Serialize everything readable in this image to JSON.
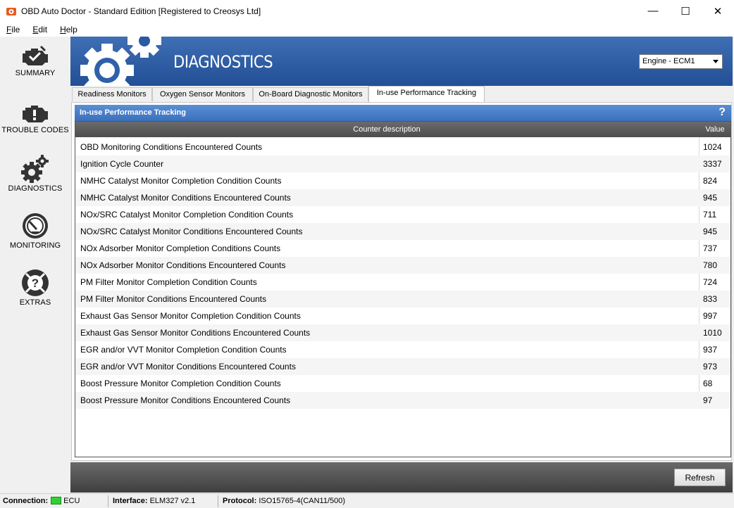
{
  "window": {
    "title": "OBD Auto Doctor - Standard Edition [Registered to Creosys Ltd]",
    "controls": {
      "minimize": "—",
      "maximize": "☐",
      "close": "✕"
    }
  },
  "menu": [
    {
      "label": "File",
      "accel": "F",
      "rest": "ile"
    },
    {
      "label": "Edit",
      "accel": "E",
      "rest": "dit"
    },
    {
      "label": "Help",
      "accel": "H",
      "rest": "elp"
    }
  ],
  "sidebar": {
    "items": [
      {
        "label": "SUMMARY",
        "icon": "engine-check-icon"
      },
      {
        "label": "TROUBLE CODES",
        "icon": "engine-warning-icon"
      },
      {
        "label": "DIAGNOSTICS",
        "icon": "gears-icon"
      },
      {
        "label": "MONITORING",
        "icon": "gauge-icon"
      },
      {
        "label": "EXTRAS",
        "icon": "help-lifebuoy-icon"
      }
    ]
  },
  "header": {
    "title": "DIAGNOSTICS",
    "ecu_selected": "Engine - ECM1"
  },
  "tabs": [
    {
      "label": "Readiness Monitors",
      "active": false
    },
    {
      "label": "Oxygen Sensor Monitors",
      "active": false
    },
    {
      "label": "On-Board Diagnostic Monitors",
      "active": false
    },
    {
      "label": "In-use Performance Tracking",
      "active": true
    }
  ],
  "panel": {
    "title": "In-use Performance Tracking",
    "help": "?",
    "columns": {
      "description": "Counter description",
      "value": "Value"
    },
    "rows": [
      {
        "desc": "OBD Monitoring Conditions Encountered Counts",
        "value": "1024"
      },
      {
        "desc": "Ignition Cycle Counter",
        "value": "3337"
      },
      {
        "desc": "NMHC Catalyst Monitor Completion Condition Counts",
        "value": "824"
      },
      {
        "desc": "NMHC Catalyst Monitor Conditions Encountered Counts",
        "value": "945"
      },
      {
        "desc": "NOx/SRC Catalyst Monitor Completion Condition Counts",
        "value": "711"
      },
      {
        "desc": "NOx/SRC Catalyst Monitor Conditions Encountered Counts",
        "value": "945"
      },
      {
        "desc": "NOx Adsorber Monitor Completion Conditions Counts",
        "value": "737"
      },
      {
        "desc": "NOx Adsorber Monitor Conditions Encountered Counts",
        "value": "780"
      },
      {
        "desc": "PM Filter Monitor Completion Condition Counts",
        "value": "724"
      },
      {
        "desc": "PM Filter Monitor Conditions Encountered Counts",
        "value": "833"
      },
      {
        "desc": "Exhaust Gas Sensor Monitor Completion Condition Counts",
        "value": "997"
      },
      {
        "desc": "Exhaust Gas Sensor Monitor Conditions Encountered Counts",
        "value": "1010"
      },
      {
        "desc": "EGR and/or VVT Monitor Completion Condition Counts",
        "value": "937"
      },
      {
        "desc": "EGR and/or VVT Monitor Conditions Encountered Counts",
        "value": "973"
      },
      {
        "desc": "Boost Pressure Monitor Completion Condition Counts",
        "value": "68"
      },
      {
        "desc": "Boost Pressure Monitor Conditions Encountered Counts",
        "value": "97"
      }
    ]
  },
  "buttons": {
    "refresh": "Refresh"
  },
  "status": {
    "connection_label": "Connection:",
    "connection_value": "ECU",
    "connection_color": "#2fd12f",
    "interface_label": "Interface:",
    "interface_value": "ELM327 v2.1",
    "protocol_label": "Protocol:",
    "protocol_value": "ISO15765-4(CAN11/500)"
  },
  "colors": {
    "banner": "#2d5ea8",
    "section_header": "#4a80c9",
    "grid_header": "#5a5a5a"
  }
}
